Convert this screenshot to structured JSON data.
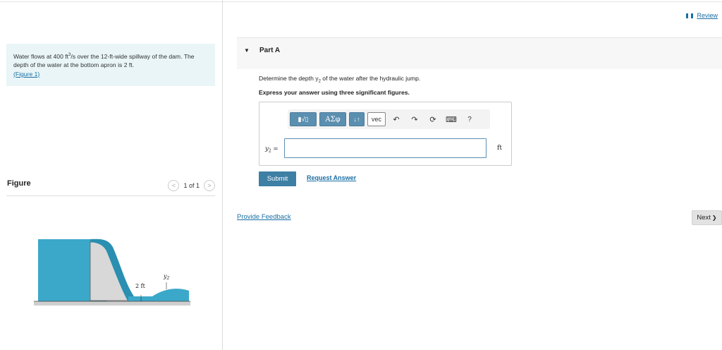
{
  "problem": {
    "text_before": "Water flows at 400 ",
    "flow_unit_base": "ft",
    "flow_unit_exp": "3",
    "text_mid": "/s over the 12-ft-wide spillway of the dam. The depth of the water at the bottom apron is 2 ",
    "depth_unit": "ft",
    "text_after": ".",
    "figure_link": "(Figure 1)"
  },
  "figure": {
    "title": "Figure",
    "pager_text": "1 of 1",
    "prev_icon": "chevron-left-icon",
    "next_icon": "chevron-right-icon",
    "label_depth": "2 ft",
    "label_y2": "y",
    "label_y2_sub": "2",
    "colors": {
      "water": "#3ba8c9",
      "water_dark": "#2a8fb0",
      "dam": "#d8d8d8",
      "ground": "#cfcfcf"
    }
  },
  "header": {
    "review_label": "Review",
    "review_icon": "review-icon"
  },
  "part": {
    "title": "Part A",
    "toggle_icon": "triangle-down-icon",
    "question": "Determine the depth y",
    "question_sub": "2",
    "question_rest": " of the water after the hydraulic jump.",
    "instruction": "Express your answer using three significant figures."
  },
  "toolbar": {
    "templates_label": "▮√▯",
    "greek_label": "ΑΣφ",
    "arrows_label": "↓↑",
    "vec_label": "vec",
    "undo_icon": "undo-icon",
    "redo_icon": "redo-icon",
    "reset_icon": "reset-icon",
    "keyboard_icon": "keyboard-icon",
    "help_label": "?"
  },
  "answer": {
    "variable": "y",
    "variable_sub": "2",
    "equals": " =",
    "value": "",
    "unit": "ft"
  },
  "actions": {
    "submit_label": "Submit",
    "request_label": "Request Answer",
    "feedback_label": "Provide Feedback",
    "next_label": "Next",
    "next_icon_glyph": "❯"
  },
  "colors": {
    "accent": "#3e7fa4",
    "link": "#1a6fa5",
    "problem_bg": "#e9f5f7"
  }
}
